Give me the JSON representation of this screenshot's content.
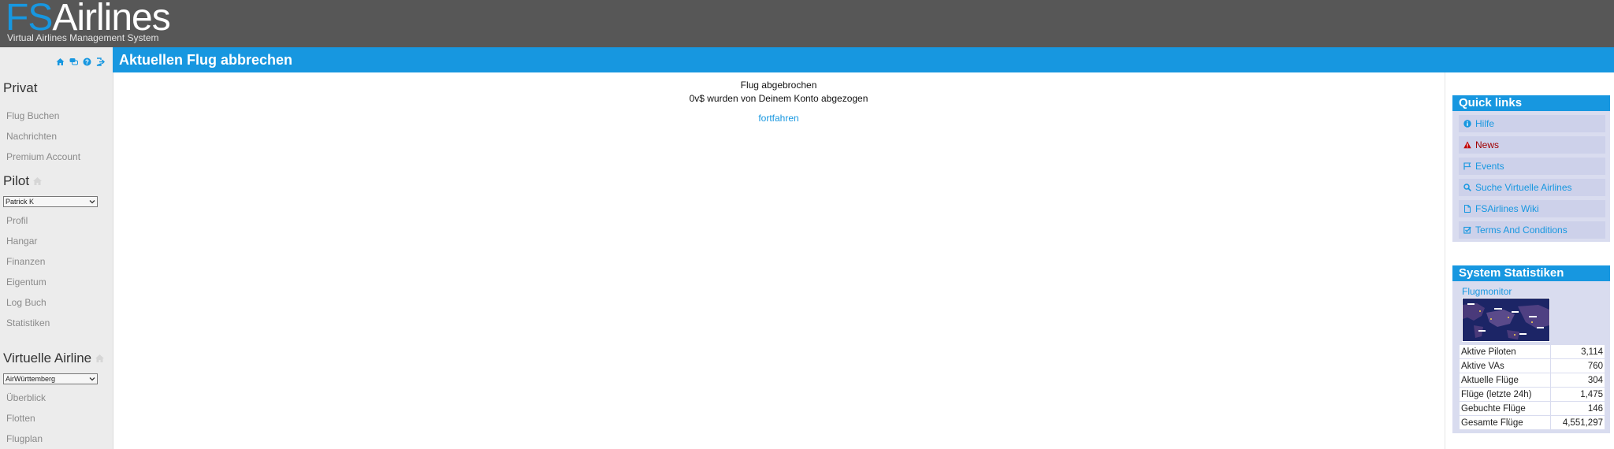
{
  "header": {
    "logo_fs": "FS",
    "logo_airlines": "Airlines",
    "tagline": "Virtual Airlines Management System"
  },
  "sidebar": {
    "top_icons": [
      "home-icon",
      "chat-icon",
      "help-icon",
      "logout-icon"
    ],
    "sections": {
      "privat": {
        "title": "Privat",
        "items": [
          "Flug Buchen",
          "Nachrichten",
          "Premium Account"
        ]
      },
      "pilot": {
        "title": "Pilot",
        "selected": "Patrick K",
        "items": [
          "Profil",
          "Hangar",
          "Finanzen",
          "Eigentum",
          "Log Buch",
          "Statistiken"
        ]
      },
      "va": {
        "title": "Virtuelle Airline",
        "selected": "AirWürttemberg",
        "items": [
          "Überblick",
          "Flotten",
          "Flugplan"
        ]
      }
    }
  },
  "main": {
    "title": "Aktuellen Flug abbrechen",
    "message_line1": "Flug abgebrochen",
    "message_line2": "0v$ wurden von Deinem Konto abgezogen",
    "continue_label": "fortfahren"
  },
  "quick_links": {
    "title": "Quick links",
    "items": [
      {
        "label": "Hilfe",
        "icon": "info-icon"
      },
      {
        "label": "News",
        "icon": "warning-icon"
      },
      {
        "label": "Events",
        "icon": "flag-icon"
      },
      {
        "label": "Suche Virtuelle Airlines",
        "icon": "search-icon"
      },
      {
        "label": "FSAirlines Wiki",
        "icon": "document-icon"
      },
      {
        "label": "Terms And Conditions",
        "icon": "checkbox-icon"
      }
    ]
  },
  "system_stats": {
    "title": "System Statistiken",
    "flugmonitor_label": "Flugmonitor",
    "rows": [
      {
        "label": "Aktive Piloten",
        "value": "3,114"
      },
      {
        "label": "Aktive VAs",
        "value": "760"
      },
      {
        "label": "Aktuelle Flüge",
        "value": "304"
      },
      {
        "label": "Flüge (letzte 24h)",
        "value": "1,475"
      },
      {
        "label": "Gebuchte Flüge",
        "value": "146"
      },
      {
        "label": "Gesamte Flüge",
        "value": "4,551,297"
      }
    ]
  },
  "colors": {
    "accent": "#1797e0",
    "header_bg": "#575757",
    "sidebar_bg": "#ececec",
    "panel_bg": "#d9dcef",
    "news_red": "#a00000"
  }
}
